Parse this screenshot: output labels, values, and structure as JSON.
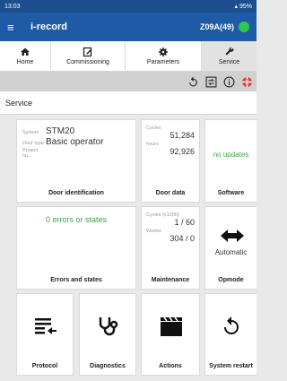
{
  "statusbar": {
    "time": "13:03",
    "battery": "95%"
  },
  "appbar": {
    "title": "i-record",
    "device": "Z09A(49)"
  },
  "tabs": [
    {
      "label": "Home",
      "icon": "home-icon"
    },
    {
      "label": "Commissioning",
      "icon": "edit-icon"
    },
    {
      "label": "Parameters",
      "icon": "gear-icon"
    },
    {
      "label": "Service",
      "icon": "wrench-icon"
    }
  ],
  "section": {
    "title": "Service"
  },
  "door": {
    "system_label": "System",
    "system_value": "STM20",
    "door_type_label": "Door type",
    "door_type_value": "Basic operator",
    "project_label": "Project nu...",
    "project_value": "",
    "caption": "Door identification"
  },
  "doordata": {
    "cycles_label": "Cycles",
    "cycles_value": "51,284",
    "hours_label": "hours",
    "hours_value": "92,926",
    "caption": "Door data"
  },
  "software": {
    "status": "no updates",
    "caption": "Software"
  },
  "errors": {
    "status": "0 errors or states",
    "caption": "Errors and states"
  },
  "maintenance": {
    "cycles_label": "Cycles (x1000)",
    "cycles_value": "1 / 60",
    "weeks_label": "Weeks",
    "weeks_value": "304 / 0",
    "caption": "Maintenance"
  },
  "opmode": {
    "value": "Automatic",
    "caption": "Opmode"
  },
  "bottom": [
    {
      "caption": "Protocol",
      "icon": "protocol-list-icon"
    },
    {
      "caption": "Diagnostics",
      "icon": "stethoscope-icon"
    },
    {
      "caption": "Actions",
      "icon": "clapperboard-icon"
    },
    {
      "caption": "System restart",
      "icon": "restart-icon"
    }
  ],
  "colors": {
    "statusbar": "#1d4f8f",
    "appbar": "#1f5aa6",
    "online": "#2ec84a",
    "green_text": "#3aa646",
    "alert": "#e53935"
  }
}
